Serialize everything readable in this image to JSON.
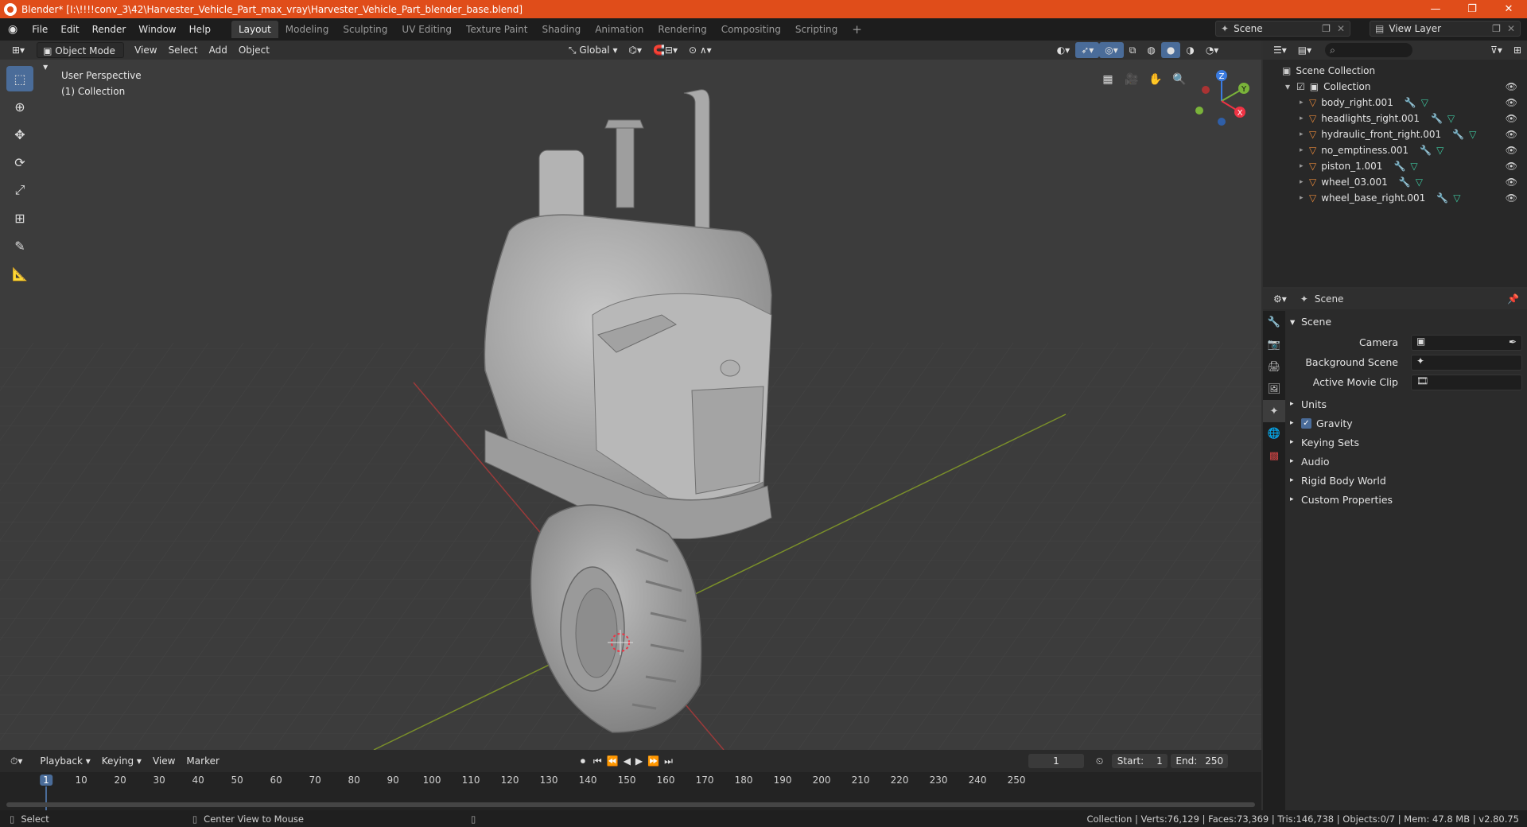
{
  "window": {
    "title": "Blender* [I:\\!!!!conv_3\\42\\Harvester_Vehicle_Part_max_vray\\Harvester_Vehicle_Part_blender_base.blend]",
    "minimize": "—",
    "maximize": "❐",
    "close": "✕"
  },
  "menu": [
    "File",
    "Edit",
    "Render",
    "Window",
    "Help"
  ],
  "workspaces": [
    "Layout",
    "Modeling",
    "Sculpting",
    "UV Editing",
    "Texture Paint",
    "Shading",
    "Animation",
    "Rendering",
    "Compositing",
    "Scripting"
  ],
  "add_workspace": "+",
  "scene_name": "Scene",
  "view_layer": "View Layer",
  "viewport": {
    "mode": "Object Mode",
    "menus": [
      "View",
      "Select",
      "Add",
      "Object"
    ],
    "transform": "Global",
    "perspective": "User Perspective",
    "collection": "(1) Collection",
    "gizmo": {
      "x": "X",
      "y": "Y",
      "z": "Z"
    }
  },
  "outliner": {
    "root": "Scene Collection",
    "collection": "Collection",
    "objects": [
      "body_right.001",
      "headlights_right.001",
      "hydraulic_front_right.001",
      "no_emptiness.001",
      "piston_1.001",
      "wheel_03.001",
      "wheel_base_right.001"
    ]
  },
  "properties": {
    "context": "Scene",
    "panel": "Scene",
    "camera_label": "Camera",
    "background_scene_label": "Background Scene",
    "active_movie_clip_label": "Active Movie Clip",
    "sections": [
      "Units",
      "Gravity",
      "Keying Sets",
      "Audio",
      "Rigid Body World",
      "Custom Properties"
    ]
  },
  "timeline": {
    "menus": [
      "Playback",
      "Keying",
      "View",
      "Marker"
    ],
    "current_frame": "1",
    "start_label": "Start:",
    "start": "1",
    "end_label": "End:",
    "end": "250",
    "ruler": [
      "1",
      "10",
      "20",
      "30",
      "40",
      "50",
      "60",
      "70",
      "80",
      "90",
      "100",
      "110",
      "120",
      "130",
      "140",
      "150",
      "160",
      "170",
      "180",
      "190",
      "200",
      "210",
      "220",
      "230",
      "240",
      "250"
    ]
  },
  "status": {
    "select": "Select",
    "center": "Center View to Mouse",
    "stats": "Collection | Verts:76,129 | Faces:73,369 | Tris:146,738 | Objects:0/7 | Mem: 47.8 MB | v2.80.75"
  },
  "colors": {
    "accent": "#4a6c99",
    "titlebar": "#e04d1a",
    "object_icon": "#e8893a",
    "mesh_icon": "#3ec8a0"
  }
}
